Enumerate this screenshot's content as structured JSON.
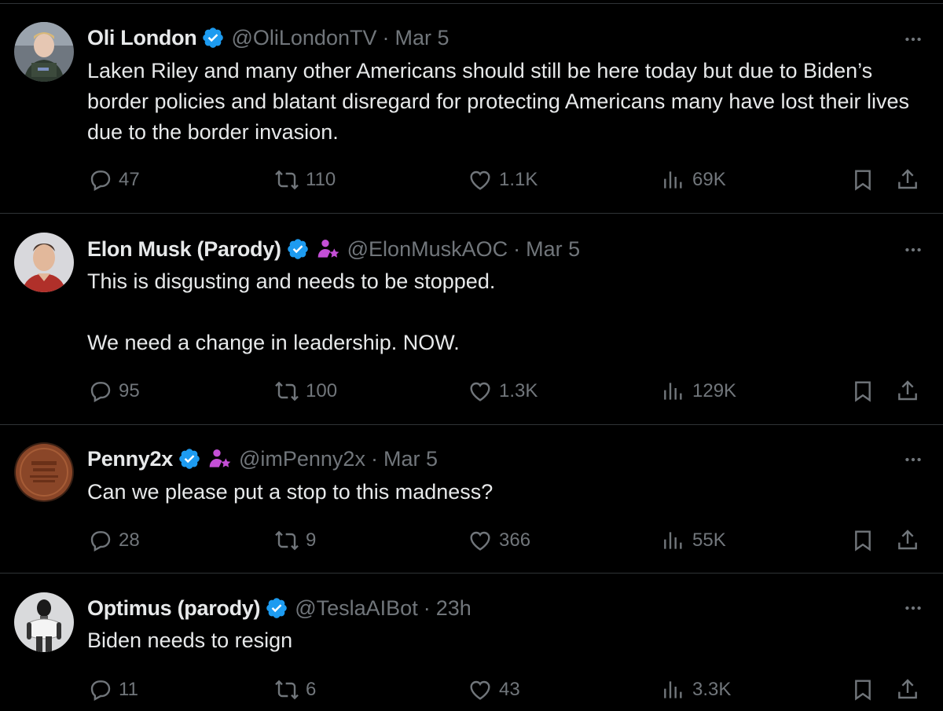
{
  "tweets": [
    {
      "name": "Oli London",
      "handle": "@OliLondonTV",
      "time": "Mar 5",
      "text": "Laken Riley and many other Americans should still be here today but due to Biden’s border policies and blatant disregard for protecting Americans many have lost their lives due to the border invasion.",
      "replies": "47",
      "retweets": "110",
      "likes": "1.1K",
      "views": "69K",
      "affiliate_badge": false
    },
    {
      "name": "Elon Musk (Parody)",
      "handle": "@ElonMuskAOC",
      "time": "Mar 5",
      "text": "This is disgusting and needs to be stopped.\n\nWe need a change in leadership. NOW.",
      "replies": "95",
      "retweets": "100",
      "likes": "1.3K",
      "views": "129K",
      "affiliate_badge": true
    },
    {
      "name": "Penny2x",
      "handle": "@imPenny2x",
      "time": "Mar 5",
      "text": "Can we please put a stop to this madness?",
      "replies": "28",
      "retweets": "9",
      "likes": "366",
      "views": "55K",
      "affiliate_badge": true
    },
    {
      "name": "Optimus (parody)",
      "handle": "@TeslaAIBot",
      "time": "23h",
      "text": "Biden needs to resign",
      "replies": "11",
      "retweets": "6",
      "likes": "43",
      "views": "3.3K",
      "affiliate_badge": false
    }
  ],
  "separator": "·",
  "colors": {
    "background": "#000000",
    "text_primary": "#e7e9ea",
    "text_secondary": "#71767b",
    "verified_blue": "#1d9bf0",
    "affiliate_purple": "#c44fd6",
    "divider": "#2f3336"
  },
  "icons": {
    "reply": "reply-icon",
    "retweet": "retweet-icon",
    "like": "heart-icon",
    "views": "views-icon",
    "bookmark": "bookmark-icon",
    "share": "share-icon",
    "more": "more-icon",
    "verified": "verified-badge-icon",
    "affiliate": "affiliate-badge-icon"
  }
}
